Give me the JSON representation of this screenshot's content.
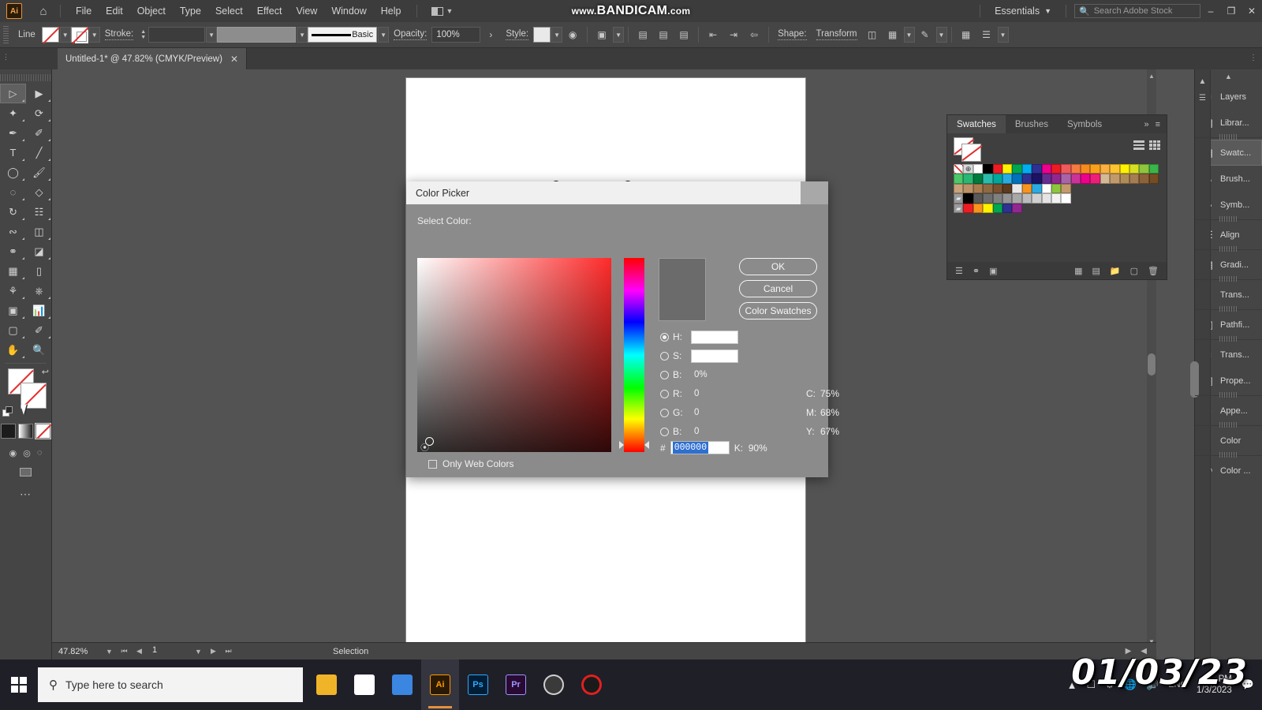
{
  "app": {
    "name": "Adobe Illustrator",
    "logo_text": "Ai",
    "workspace": "Essentials",
    "stock_placeholder": "Search Adobe Stock",
    "watermark_prefix": "www.",
    "watermark_brand": "BANDICAM",
    "watermark_suffix": ".com"
  },
  "menu": {
    "items": [
      "File",
      "Edit",
      "Object",
      "Type",
      "Select",
      "Effect",
      "View",
      "Window",
      "Help"
    ]
  },
  "window_buttons": {
    "minimize": "–",
    "restore": "❐",
    "close": "✕"
  },
  "control_bar": {
    "object_label": "Line",
    "stroke_label": "Stroke:",
    "stroke_weight": "",
    "stroke_profile": "",
    "brush_label": "Basic",
    "opacity_label": "Opacity:",
    "opacity_value": "100%",
    "style_label": "Style:",
    "shape_label": "Shape:",
    "transform_label": "Transform"
  },
  "document": {
    "tab_title": "Untitled-1* @ 47.82% (CMYK/Preview)",
    "close_glyph": "✕"
  },
  "status_bar": {
    "zoom": "47.82%",
    "page": "1",
    "tool": "Selection"
  },
  "color_picker": {
    "title": "Color Picker",
    "select_color_label": "Select Color:",
    "buttons": {
      "ok": "OK",
      "cancel": "Cancel",
      "color_swatches": "Color Swatches"
    },
    "hsb": [
      {
        "key": "H:",
        "value": "",
        "selected": true,
        "unit": ""
      },
      {
        "key": "S:",
        "value": "",
        "selected": false,
        "unit": ""
      },
      {
        "key": "B:",
        "value": "0%",
        "selected": false,
        "unit": "%"
      }
    ],
    "rgb": [
      {
        "key": "R:",
        "value": "0",
        "selected": false
      },
      {
        "key": "G:",
        "value": "0",
        "selected": false
      },
      {
        "key": "B:",
        "value": "0",
        "selected": false
      }
    ],
    "cmyk": [
      {
        "key": "C:",
        "value": "75%"
      },
      {
        "key": "M:",
        "value": "68%"
      },
      {
        "key": "Y:",
        "value": "67%"
      },
      {
        "key": "K:",
        "value": "90%"
      }
    ],
    "hex_symbol": "#",
    "hex_value": "000000",
    "only_web_colors": "Only Web Colors",
    "preview_color": "#6b6b6b"
  },
  "swatches_panel": {
    "tabs": [
      "Swatches",
      "Brushes",
      "Symbols"
    ],
    "active_tab": "Swatches",
    "expand_glyph": "»",
    "menu_glyph": "≡",
    "rows": [
      [
        "none",
        "registration",
        "#ffffff",
        "#000000",
        "#ed1c24",
        "#fff200",
        "#00a650",
        "#00aeef",
        "#2e3192",
        "#ec008c",
        "#ed1c24",
        "#f15a5a",
        "#f47b42",
        "#f68b1f",
        "#f9a11b",
        "#fbb040",
        "#fdc431",
        "#fff200",
        "#d7df23",
        "#8dc63f",
        "#39b54a"
      ],
      [
        "#4cc76a",
        "#2bb673",
        "#007b3e",
        "#2bbbad",
        "#00a79d",
        "#29abe2",
        "#0072bc",
        "#2e3192",
        "#1b1464",
        "#662d91",
        "#92278f",
        "#a864a8",
        "#cc3399",
        "#ec008c",
        "#ed1e79",
        "#d3b996",
        "#c19a6b",
        "#b08d57",
        "#a67c52",
        "#8c6239",
        "#754c24"
      ],
      [
        "#c8a27a",
        "#bb9167",
        "#a97c50",
        "#8e6a43",
        "#7a5230",
        "#5c3a1e",
        "#e8e8e8",
        "#f7941e",
        "#29abe2",
        "#ffffff",
        "#8cc63f",
        "#c49a6c"
      ],
      [
        "folder",
        "#000000",
        "#595959",
        "#6d6d6d",
        "#808080",
        "#949494",
        "#a8a8a8",
        "#bcbcbc",
        "#d0d0d0",
        "#e4e4e4",
        "#f2f2f2",
        "#ffffff"
      ],
      [
        "folder",
        "#ed1c24",
        "#f7941e",
        "#fff200",
        "#00a650",
        "#2e3192",
        "#92278f"
      ]
    ]
  },
  "dock": {
    "items": [
      {
        "label": "Layers",
        "icon": "layers-icon"
      },
      {
        "label": "Librar...",
        "icon": "libraries-icon"
      },
      {
        "label": "Swatc...",
        "icon": "swatches-icon",
        "active": true
      },
      {
        "label": "Brush...",
        "icon": "brushes-icon"
      },
      {
        "label": "Symb...",
        "icon": "symbols-icon"
      },
      {
        "label": "Align",
        "icon": "align-icon"
      },
      {
        "label": "Gradi...",
        "icon": "gradient-icon"
      },
      {
        "label": "Trans...",
        "icon": "transparency-icon"
      },
      {
        "label": "Pathfi...",
        "icon": "pathfinder-icon"
      },
      {
        "label": "Trans...",
        "icon": "transform-icon"
      },
      {
        "label": "Prope...",
        "icon": "properties-icon"
      },
      {
        "label": "Appe...",
        "icon": "appearance-icon"
      },
      {
        "label": "Color",
        "icon": "color-icon"
      },
      {
        "label": "Color ...",
        "icon": "color-guide-icon"
      }
    ]
  },
  "toolbar": {
    "tools": [
      [
        "selection-tool",
        "direct-selection-tool"
      ],
      [
        "magic-wand-tool",
        "lasso-tool"
      ],
      [
        "pen-tool",
        "curvature-tool"
      ],
      [
        "type-tool",
        "line-segment-tool"
      ],
      [
        "ellipse-tool",
        "paintbrush-tool"
      ],
      [
        "shaper-tool",
        "eraser-tool"
      ],
      [
        "rotate-tool",
        "scale-tool"
      ],
      [
        "width-tool",
        "free-transform-tool"
      ],
      [
        "shape-builder-tool",
        "perspective-grid-tool"
      ],
      [
        "mesh-tool",
        "gradient-tool"
      ],
      [
        "eyedropper-tool",
        "blend-tool"
      ],
      [
        "symbol-sprayer-tool",
        "column-graph-tool"
      ],
      [
        "artboard-tool",
        "slice-tool"
      ],
      [
        "hand-tool",
        "zoom-tool"
      ]
    ]
  },
  "taskbar": {
    "search_placeholder": "Type here to search",
    "apps": [
      {
        "name": "file-explorer",
        "label": "",
        "color": "#f0b429"
      },
      {
        "name": "microsoft-store",
        "label": "",
        "color": "#ffffff"
      },
      {
        "name": "mail",
        "label": "",
        "color": "#3b86e0"
      },
      {
        "name": "adobe-illustrator",
        "label": "Ai",
        "color": "#ff9a00",
        "open": true
      },
      {
        "name": "adobe-photoshop",
        "label": "Ps",
        "color": "#31a8ff"
      },
      {
        "name": "adobe-premiere",
        "label": "Pr",
        "color": "#9999ff"
      },
      {
        "name": "obs-studio",
        "label": "",
        "color": "#d8d8d8"
      },
      {
        "name": "screen-recorder",
        "label": "",
        "color": "#e02020"
      }
    ],
    "tray": {
      "language": "ENG",
      "time": "PM",
      "date": "1/3/2023"
    },
    "date_overlay": "01/03/23"
  }
}
